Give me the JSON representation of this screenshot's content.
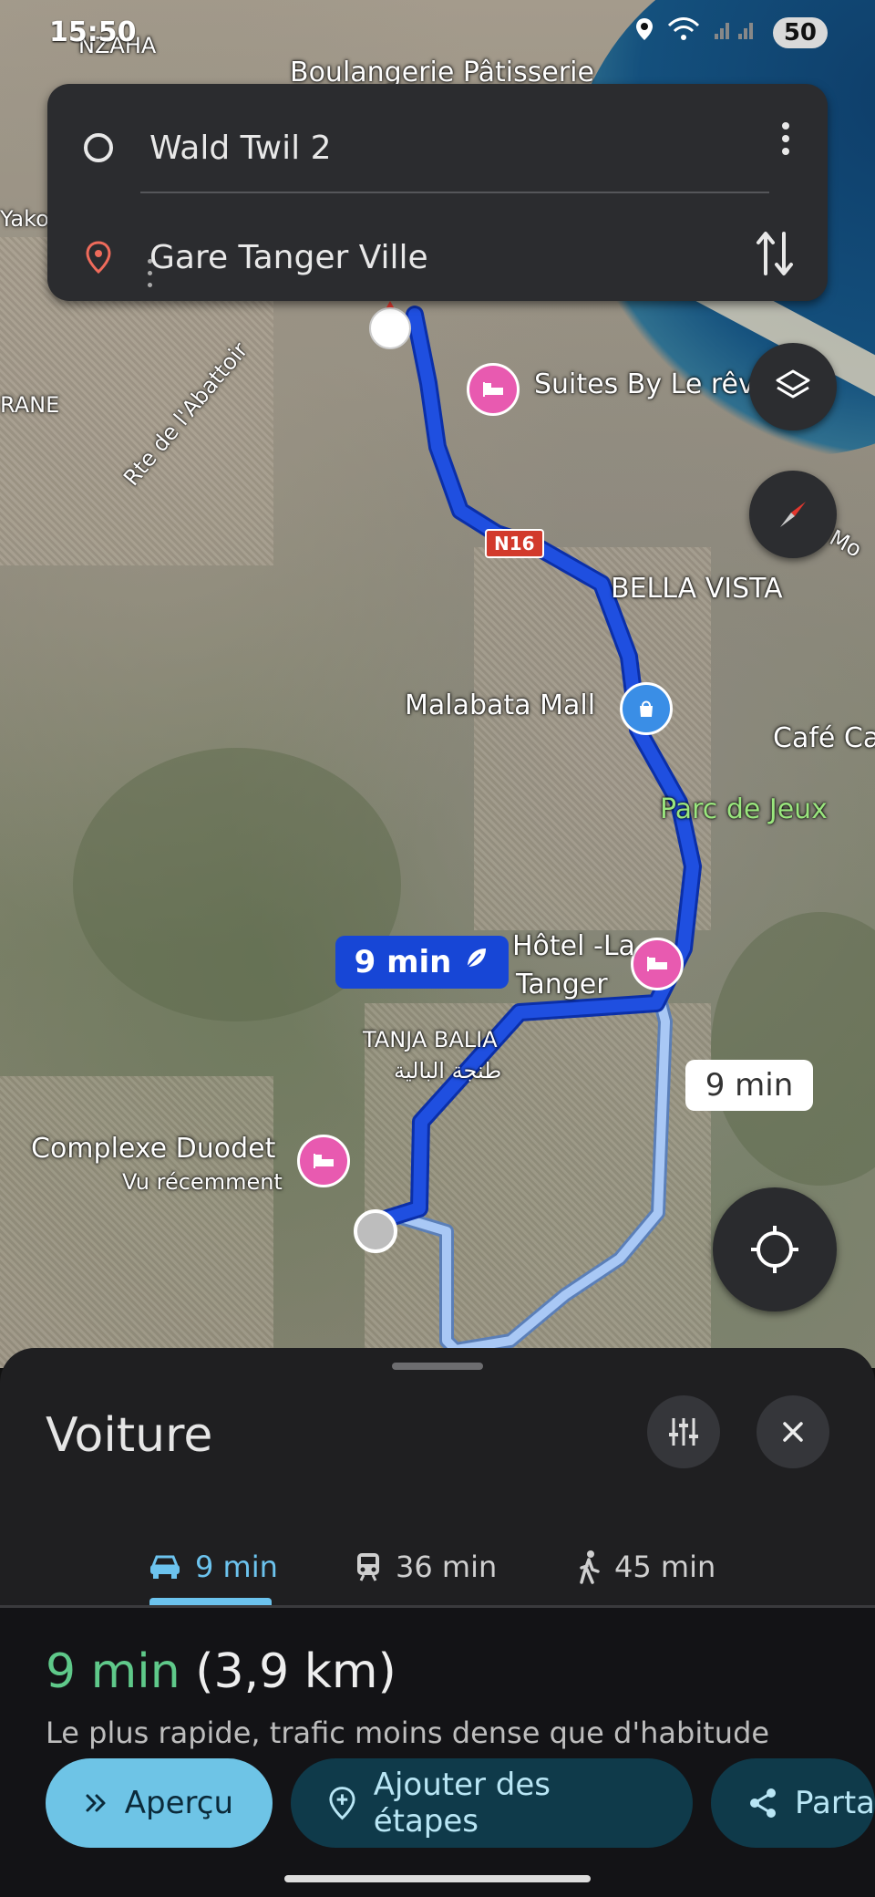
{
  "status_bar": {
    "time": "15:50",
    "battery": "50",
    "icons": [
      "location-icon",
      "wifi-icon",
      "signal-icon"
    ]
  },
  "directions": {
    "origin": "Wald Twil 2",
    "destination": "Gare Tanger Ville"
  },
  "map": {
    "labels": {
      "bakery": "Boulangerie Pâtisserie",
      "hotel_suites": "Suites By Le rêv",
      "road_abattoir": "Rte de l'Abattoir",
      "bella_vista": "BELLA VISTA",
      "malabata": "Malabata Mall",
      "cafe": "Café Ca",
      "parc": "Parc de Jeux",
      "hotel_la": "Hôtel -La",
      "hotel_tanger": "Tanger",
      "tanja_balia": "TANJA BALIA",
      "tanja_balia_ar": "طنجة البالية",
      "complexe": "Complexe Duodet",
      "recent": "Vu récemment",
      "rane": "RANE",
      "yako": "Yako",
      "nzaha": "NZAHA",
      "mo": "Mo",
      "route_shield": "N16"
    },
    "selected_route_time": "9 min",
    "alt_route_time": "9 min"
  },
  "sheet": {
    "title": "Voiture",
    "tabs": [
      {
        "label": "9 min",
        "icon": "car-icon"
      },
      {
        "label": "36 min",
        "icon": "train-icon"
      },
      {
        "label": "45 min",
        "icon": "walk-icon"
      }
    ],
    "summary_duration": "9 min",
    "summary_distance": "(3,9 km)",
    "subtext": "Le plus rapide, trafic moins dense que d'habitude",
    "actions": {
      "overview": "Aperçu",
      "add_stops": "Ajouter des étapes",
      "share": "Parta"
    }
  },
  "colors": {
    "route_selected": "#1f4fe0",
    "route_alt": "#a9c8f5",
    "accent": "#6cc3ee",
    "duration_green": "#5fc98a"
  }
}
